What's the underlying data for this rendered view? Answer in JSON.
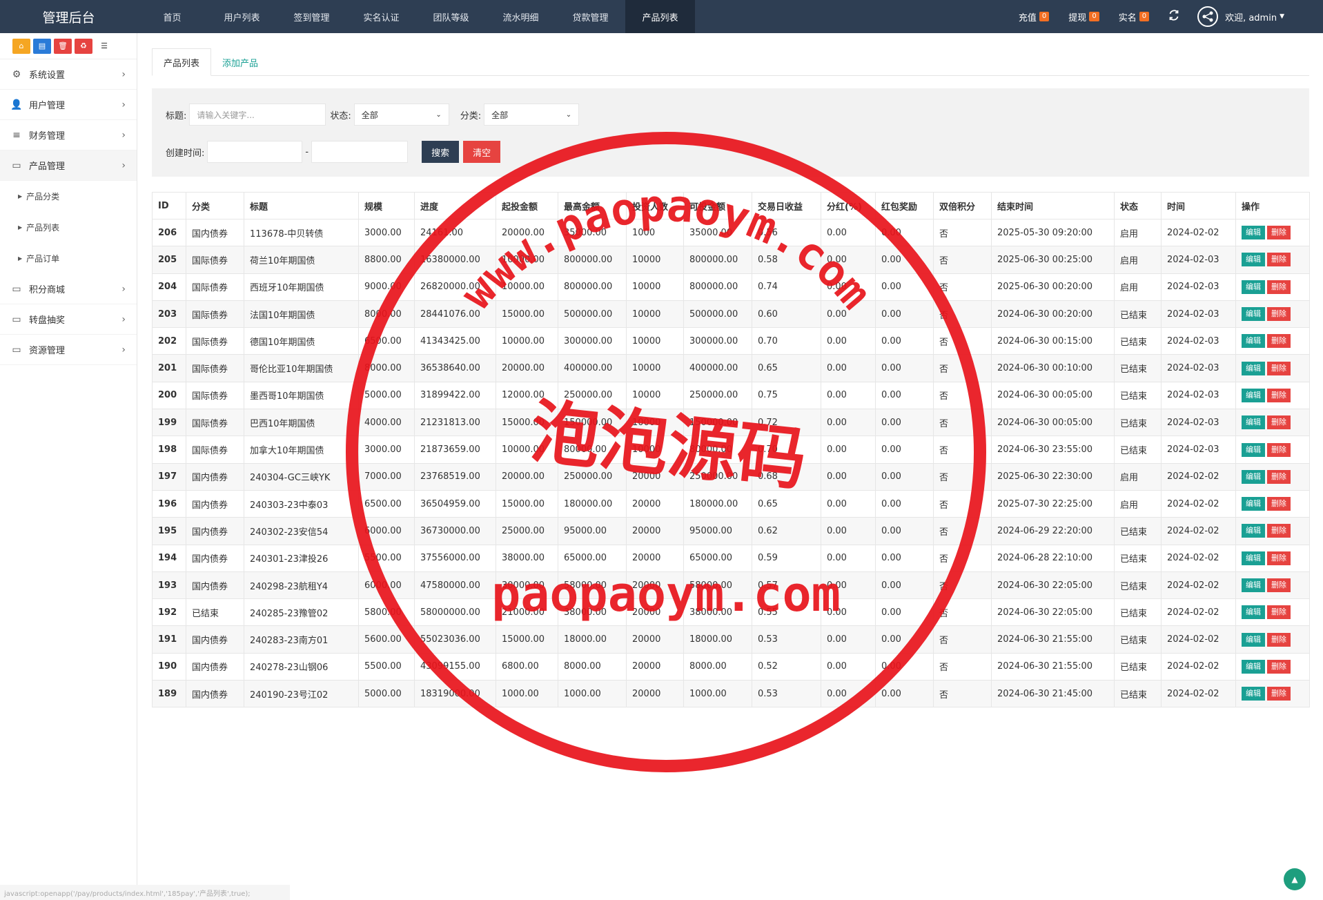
{
  "header": {
    "brand": "管理后台",
    "nav": [
      "首页",
      "用户列表",
      "签到管理",
      "实名认证",
      "团队等级",
      "流水明细",
      "贷款管理",
      "产品列表"
    ],
    "active_nav": 7,
    "recharge": {
      "label": "充值",
      "count": "0"
    },
    "withdraw": {
      "label": "提现",
      "count": "0"
    },
    "realname": {
      "label": "实名",
      "count": "0"
    },
    "welcome": "欢迎, admin"
  },
  "sidebar": {
    "menu": [
      {
        "label": "系统设置",
        "icon": "gears-icon"
      },
      {
        "label": "用户管理",
        "icon": "user-icon"
      },
      {
        "label": "财务管理",
        "icon": "database-icon"
      },
      {
        "label": "产品管理",
        "icon": "monitor-icon"
      }
    ],
    "submenu": [
      "产品分类",
      "产品列表",
      "产品订单"
    ],
    "menu2": [
      {
        "label": "积分商城",
        "icon": "monitor-icon"
      },
      {
        "label": "转盘抽奖",
        "icon": "monitor-icon"
      },
      {
        "label": "资源管理",
        "icon": "monitor-icon"
      }
    ]
  },
  "tabs": [
    "产品列表",
    "添加产品"
  ],
  "search": {
    "title_label": "标题:",
    "title_placeholder": "请输入关键字...",
    "status_label": "状态:",
    "status_value": "全部",
    "category_label": "分类:",
    "category_value": "全部",
    "created_label": "创建时间:",
    "dash": "-",
    "search_btn": "搜索",
    "clear_btn": "清空"
  },
  "table": {
    "columns": [
      "ID",
      "分类",
      "标题",
      "规模",
      "进度",
      "起投金额",
      "最高金额",
      "投资人数",
      "可投金额",
      "交易日收益",
      "分红(%)",
      "红包奖励",
      "双倍积分",
      "结束时间",
      "状态",
      "时间",
      "操作"
    ],
    "edit_label": "编辑",
    "delete_label": "删除",
    "rows": [
      [
        "206",
        "国内债券",
        "113678-中贝转债",
        "3000.00",
        "24161.00",
        "20000.00",
        "35000.00",
        "1000",
        "35000.00",
        "0.56",
        "0.00",
        "0.00",
        "否",
        "2025-05-30 09:20:00",
        "启用",
        "2024-02-02"
      ],
      [
        "205",
        "国际债券",
        "荷兰10年期国债",
        "8800.00",
        "16380000.00",
        "10000.00",
        "800000.00",
        "10000",
        "800000.00",
        "0.58",
        "0.00",
        "0.00",
        "否",
        "2025-06-30 00:25:00",
        "启用",
        "2024-02-03"
      ],
      [
        "204",
        "国际债券",
        "西班牙10年期国债",
        "9000.00",
        "26820000.00",
        "10000.00",
        "800000.00",
        "10000",
        "800000.00",
        "0.74",
        "0.00",
        "0.00",
        "否",
        "2025-06-30 00:20:00",
        "启用",
        "2024-02-03"
      ],
      [
        "203",
        "国际债券",
        "法国10年期国债",
        "8000.00",
        "28441076.00",
        "15000.00",
        "500000.00",
        "10000",
        "500000.00",
        "0.60",
        "0.00",
        "0.00",
        "否",
        "2024-06-30 00:20:00",
        "已结束",
        "2024-02-03"
      ],
      [
        "202",
        "国际债券",
        "德国10年期国债",
        "6500.00",
        "41343425.00",
        "10000.00",
        "300000.00",
        "10000",
        "300000.00",
        "0.70",
        "0.00",
        "0.00",
        "否",
        "2024-06-30 00:15:00",
        "已结束",
        "2024-02-03"
      ],
      [
        "201",
        "国际债券",
        "哥伦比亚10年期国债",
        "8000.00",
        "36538640.00",
        "20000.00",
        "400000.00",
        "10000",
        "400000.00",
        "0.65",
        "0.00",
        "0.00",
        "否",
        "2024-06-30 00:10:00",
        "已结束",
        "2024-02-03"
      ],
      [
        "200",
        "国际债券",
        "墨西哥10年期国债",
        "5000.00",
        "31899422.00",
        "12000.00",
        "250000.00",
        "10000",
        "250000.00",
        "0.75",
        "0.00",
        "0.00",
        "否",
        "2024-06-30 00:05:00",
        "已结束",
        "2024-02-03"
      ],
      [
        "199",
        "国际债券",
        "巴西10年期国债",
        "4000.00",
        "21231813.00",
        "15000.00",
        "150000.00",
        "10000",
        "150000.00",
        "0.72",
        "0.00",
        "0.00",
        "否",
        "2024-06-30 00:05:00",
        "已结束",
        "2024-02-03"
      ],
      [
        "198",
        "国际债券",
        "加拿大10年期国债",
        "3000.00",
        "21873659.00",
        "10000.00",
        "80000.00",
        "10000",
        "80000.00",
        "0.70",
        "0.00",
        "0.00",
        "否",
        "2024-06-30 23:55:00",
        "已结束",
        "2024-02-03"
      ],
      [
        "197",
        "国内债券",
        "240304-GC三峡YK",
        "7000.00",
        "23768519.00",
        "20000.00",
        "250000.00",
        "20000",
        "250000.00",
        "0.68",
        "0.00",
        "0.00",
        "否",
        "2025-06-30 22:30:00",
        "启用",
        "2024-02-02"
      ],
      [
        "196",
        "国内债券",
        "240303-23中泰03",
        "6500.00",
        "36504959.00",
        "15000.00",
        "180000.00",
        "20000",
        "180000.00",
        "0.65",
        "0.00",
        "0.00",
        "否",
        "2025-07-30 22:25:00",
        "启用",
        "2024-02-02"
      ],
      [
        "195",
        "国内债券",
        "240302-23安信54",
        "6000.00",
        "36730000.00",
        "25000.00",
        "95000.00",
        "20000",
        "95000.00",
        "0.62",
        "0.00",
        "0.00",
        "否",
        "2024-06-29 22:20:00",
        "已结束",
        "2024-02-02"
      ],
      [
        "194",
        "国内债券",
        "240301-23津投26",
        "5500.00",
        "37556000.00",
        "38000.00",
        "65000.00",
        "20000",
        "65000.00",
        "0.59",
        "0.00",
        "0.00",
        "否",
        "2024-06-28 22:10:00",
        "已结束",
        "2024-02-02"
      ],
      [
        "193",
        "国内债券",
        "240298-23航租Y4",
        "6000.00",
        "47580000.00",
        "30000.00",
        "58000.00",
        "20000",
        "58000.00",
        "0.57",
        "0.00",
        "0.00",
        "否",
        "2024-06-30 22:05:00",
        "已结束",
        "2024-02-02"
      ],
      [
        "192",
        "已结束",
        "240285-23豫管02",
        "5800.00",
        "58000000.00",
        "21000.00",
        "38000.00",
        "20000",
        "38000.00",
        "0.55",
        "0.00",
        "0.00",
        "否",
        "2024-06-30 22:05:00",
        "已结束",
        "2024-02-02"
      ],
      [
        "191",
        "国内债券",
        "240283-23南方01",
        "5600.00",
        "55023036.00",
        "15000.00",
        "18000.00",
        "20000",
        "18000.00",
        "0.53",
        "0.00",
        "0.00",
        "否",
        "2024-06-30 21:55:00",
        "已结束",
        "2024-02-02"
      ],
      [
        "190",
        "国内债券",
        "240278-23山钢06",
        "5500.00",
        "43099155.00",
        "6800.00",
        "8000.00",
        "20000",
        "8000.00",
        "0.52",
        "0.00",
        "0.00",
        "否",
        "2024-06-30 21:55:00",
        "已结束",
        "2024-02-02"
      ],
      [
        "189",
        "国内债券",
        "240190-23号江02",
        "5000.00",
        "18319000.00",
        "1000.00",
        "1000.00",
        "20000",
        "1000.00",
        "0.53",
        "0.00",
        "0.00",
        "否",
        "2024-06-30 21:45:00",
        "已结束",
        "2024-02-02"
      ]
    ]
  },
  "statusbar": "javascript:openapp('/pay/products/index.html','185pay','产品列表',true);",
  "watermark": {
    "top_text": "www.paopaoym.com",
    "middle_text": "泡泡源码",
    "bottom_text": "paopaoym.com"
  },
  "colors": {
    "topbar": "#2e3e53",
    "green": "#1aa094",
    "red": "#e64340",
    "orange": "#f26f23",
    "blue": "#2a7bd8",
    "stamp": "#e8141b"
  }
}
